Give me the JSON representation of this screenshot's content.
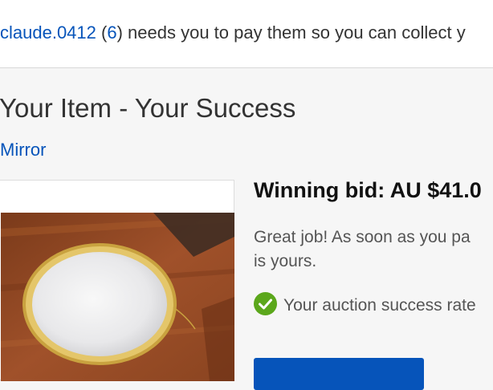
{
  "notice": {
    "seller_name": "claude.0412",
    "paren_open": " (",
    "feedback_score": "6",
    "message": ") needs you to pay them so you can collect y"
  },
  "page": {
    "title": "Your Item - Your Success",
    "item_title": "Mirror"
  },
  "bid": {
    "label": "Winning bid: AU $41.0",
    "message_line1": "Great job! As soon as you pa",
    "message_line2": "is yours.",
    "success_rate_text": "Your auction success rate"
  },
  "pay_button": {
    "label": ""
  },
  "icons": {
    "check": "check-circle-icon"
  },
  "colors": {
    "link": "#0654ba",
    "success": "#5ba71b",
    "button": "#0654ba",
    "background": "#f6f6f6"
  }
}
